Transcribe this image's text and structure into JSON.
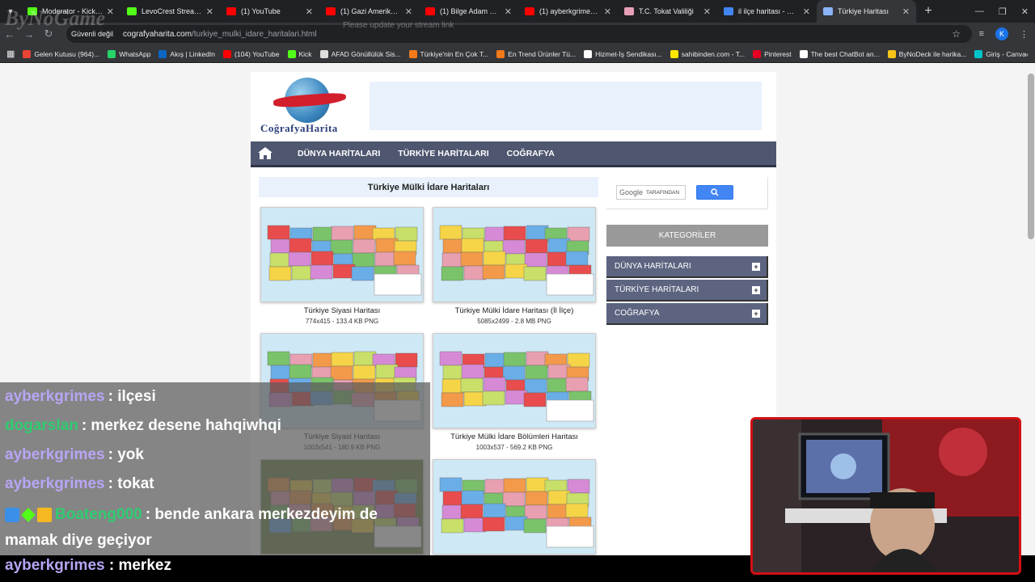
{
  "browser": {
    "tabs": [
      {
        "title": "Moderator - Kick Da",
        "color": "#53fc18"
      },
      {
        "title": "LevoCrest Stream - W",
        "color": "#53fc18"
      },
      {
        "title": "(1) YouTube",
        "color": "#ff0000"
      },
      {
        "title": "(1) Gazi Amerikan Ası",
        "color": "#ff0000"
      },
      {
        "title": "(1) Bilge Adam Reis -",
        "color": "#ff0000"
      },
      {
        "title": "(1) ayberkgrimes - Yo",
        "color": "#ff0000"
      },
      {
        "title": "T.C. Tokat Valiliği",
        "color": "#e8a0b8"
      },
      {
        "title": "il ilçe haritası - Goog",
        "color": "#4285f4"
      },
      {
        "title": "Türkiye Haritası",
        "color": "#8ab4f8",
        "active": true
      }
    ],
    "security_label": "Güvenli değil",
    "url_host": "cografyaharita.com",
    "url_path": "/turkiye_mulki_idare_haritalari.html",
    "profile_initial": "K",
    "bookmarks": [
      {
        "label": "Gelen Kutusu (964)...",
        "color": "#ea4335"
      },
      {
        "label": "WhatsApp",
        "color": "#25d366"
      },
      {
        "label": "Akış | LinkedIn",
        "color": "#0a66c2"
      },
      {
        "label": "(104) YouTube",
        "color": "#ff0000"
      },
      {
        "label": "Kick",
        "color": "#53fc18"
      },
      {
        "label": "AFAD Gönüllülük Sis...",
        "color": "#dddddd"
      },
      {
        "label": "Türkiye'nin En Çok T...",
        "color": "#f27a1a"
      },
      {
        "label": "En Trend Ürünler Tü...",
        "color": "#f27a1a"
      },
      {
        "label": "Hizmet-İş Sendikası...",
        "color": "#ffffff"
      },
      {
        "label": "sahibinden.com - T...",
        "color": "#ffe800"
      },
      {
        "label": "Pinterest",
        "color": "#e60023"
      },
      {
        "label": "The best ChatBot an...",
        "color": "#ffffff"
      },
      {
        "label": "ByNoDeck ile harika...",
        "color": "#f5c518"
      },
      {
        "label": "Giriş - Canva",
        "color": "#00c4cc"
      }
    ]
  },
  "stream_notice": "Please update your stream link",
  "overlay_logo": "ByNoGame",
  "site": {
    "logo_text": "CoğrafyaHarita",
    "nav": [
      "DÜNYA HARİTALARI",
      "TÜRKİYE HARİTALARI",
      "COĞRAFYA"
    ],
    "category_title": "Türkiye Mülki İdare Haritaları",
    "cards": [
      {
        "title": "Türkiye Siyasi Haritası",
        "meta": "774x415 - 133.4 KB PNG"
      },
      {
        "title": "Türkiye Mülki İdare Haritası (İl İlçe)",
        "meta": "5085x2499 - 2.8 MB PNG"
      },
      {
        "title": "Türkiye Siyasi Haritası",
        "meta": "1003x541 - 180.9 KB PNG"
      },
      {
        "title": "Türkiye Mülki İdare Bölümleri Haritası",
        "meta": "1003x537 - 569.2 KB PNG"
      },
      {
        "title": "",
        "meta": ""
      },
      {
        "title": "",
        "meta": ""
      }
    ],
    "search": {
      "google_label": "Google",
      "placeholder": "TARAFINDAN"
    },
    "kategori_label": "KATEGORİLER",
    "kategori_items": [
      "DÜNYA HARİTALARI",
      "TÜRKİYE HARİTALARI",
      "COĞRAFYA"
    ]
  },
  "chat": [
    {
      "user": "ayberkgrimes",
      "user_color": "#b9a5f5",
      "text": "ilçesi"
    },
    {
      "user": "dogarslan",
      "user_color": "#2ecc71",
      "text": "merkez desene hahqiwhqi"
    },
    {
      "user": "ayberkgrimes",
      "user_color": "#b9a5f5",
      "text": "yok"
    },
    {
      "user": "ayberkgrimes",
      "user_color": "#b9a5f5",
      "text": "tokat"
    },
    {
      "user": "Boateng000",
      "user_color": "#2ecc71",
      "text": "bende ankara merkezdeyim de mamak diye geçiyor"
    }
  ],
  "chat_last": {
    "user": "ayberkgrimes",
    "text": "merkez"
  }
}
